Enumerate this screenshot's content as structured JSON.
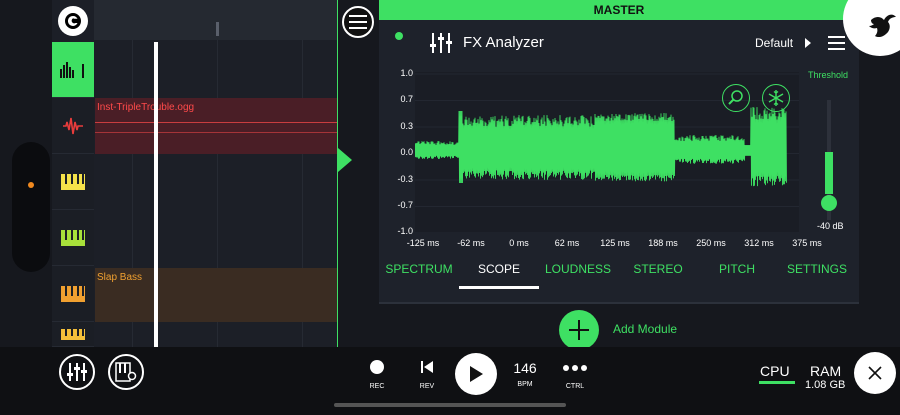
{
  "master": {
    "title": "MASTER"
  },
  "fx": {
    "title": "FX Analyzer",
    "preset": "Default",
    "threshold_label": "Threshold",
    "threshold_value": "-40 dB",
    "y_ticks": [
      "1.0",
      "0.7",
      "0.3",
      "0.0",
      "-0.3",
      "-0.7",
      "-1.0"
    ],
    "x_ticks": [
      "-125 ms",
      "-62 ms",
      "0 ms",
      "62 ms",
      "125 ms",
      "188 ms",
      "250 ms",
      "312 ms",
      "375 ms"
    ],
    "tabs": [
      "SPECTRUM",
      "SCOPE",
      "LOUDNESS",
      "STEREO",
      "PITCH",
      "SETTINGS"
    ],
    "active_tab": "SCOPE",
    "add_module": "Add Module"
  },
  "tracks": {
    "clips": [
      {
        "label": "Inst-TripleTrouble.ogg",
        "color": "#ff4a4a"
      },
      {
        "label": "Slap Bass",
        "color": "#f0a030"
      }
    ]
  },
  "transport": {
    "rec": "REC",
    "rev": "REV",
    "bpm": "146",
    "bpm_label": "BPM",
    "ctrl": "CTRL"
  },
  "status": {
    "cpu": "CPU",
    "ram": "RAM",
    "ram_value": "1.08 GB"
  },
  "colors": {
    "accent": "#3ee063",
    "clip_red": "#ff4a4a",
    "clip_orange": "#f0a030"
  }
}
